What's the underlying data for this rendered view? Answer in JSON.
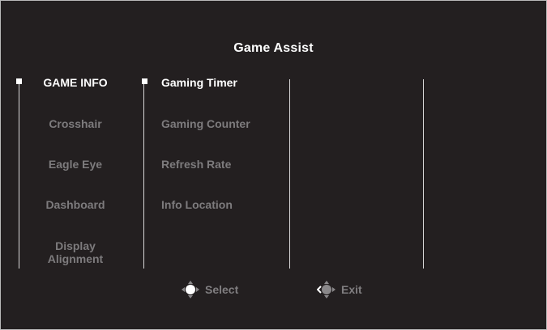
{
  "title": "Game Assist",
  "menu": {
    "items": [
      {
        "label": "GAME INFO",
        "active": true
      },
      {
        "label": "Crosshair",
        "active": false
      },
      {
        "label": "Eagle Eye",
        "active": false
      },
      {
        "label": "Dashboard",
        "active": false
      },
      {
        "label": "Display Alignment",
        "active": false
      }
    ]
  },
  "submenu": {
    "items": [
      {
        "label": "Gaming Timer",
        "active": true
      },
      {
        "label": "Gaming Counter",
        "active": false
      },
      {
        "label": "Refresh Rate",
        "active": false
      },
      {
        "label": "Info Location",
        "active": false
      }
    ]
  },
  "footer": {
    "select_label": "Select",
    "exit_label": "Exit"
  },
  "colors": {
    "background": "#231f20",
    "active_text": "#ffffff",
    "inactive_text": "#7d7b7d",
    "divider": "#d7d7d7"
  },
  "icons": {
    "select": "joystick-center-icon",
    "exit": "joystick-left-icon"
  }
}
